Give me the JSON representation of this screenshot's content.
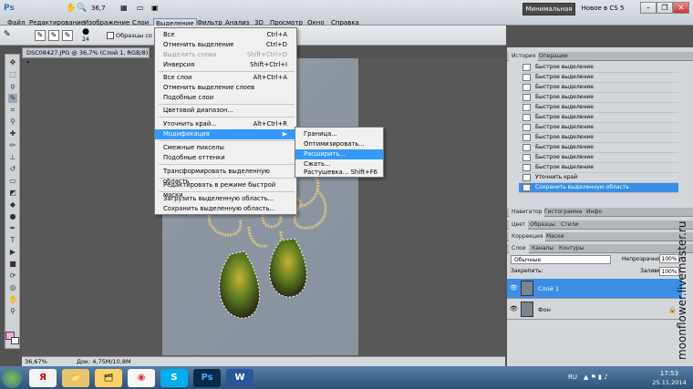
{
  "app": {
    "logo": "Ps",
    "menus": [
      "Файл",
      "Редактирование",
      "Изображение",
      "Слои",
      "Выделение",
      "Фильтр",
      "Анализ",
      "3D",
      "Просмотр",
      "Окно",
      "Справка"
    ],
    "zoom_display": "36,7",
    "workspace_button": "Минимальная",
    "news_button": "Новое в CS 5"
  },
  "options_bar": {
    "brush_size": "24",
    "sample_all_layers": "Образцы со всех сл"
  },
  "document": {
    "tab_title": "DSC08427.JPG @ 36,7% (Слой 1, RGB/8) *",
    "zoom": "36,67%",
    "doc_size": "Док: 4,75M/10,8M"
  },
  "select_menu": {
    "items": [
      {
        "label": "Все",
        "shortcut": "Ctrl+A"
      },
      {
        "label": "Отменить выделение",
        "shortcut": "Ctrl+D"
      },
      {
        "label": "Выделить снова",
        "shortcut": "Shift+Ctrl+D"
      },
      {
        "label": "Инверсия",
        "shortcut": "Shift+Ctrl+I"
      },
      {
        "label": "Все слои",
        "shortcut": "Alt+Ctrl+A"
      },
      {
        "label": "Отменить выделение слоев",
        "shortcut": ""
      },
      {
        "label": "Подобные слои",
        "shortcut": ""
      },
      {
        "label": "Цветовой диапазон...",
        "shortcut": ""
      },
      {
        "label": "Уточнить край...",
        "shortcut": "Alt+Ctrl+R"
      },
      {
        "label": "Модификация",
        "shortcut": ""
      },
      {
        "label": "Смежные пикселы",
        "shortcut": ""
      },
      {
        "label": "Подобные оттенки",
        "shortcut": ""
      },
      {
        "label": "Трансформировать выделенную область",
        "shortcut": ""
      },
      {
        "label": "Редактировать в режиме быстрой маски",
        "shortcut": ""
      },
      {
        "label": "Загрузить выделенную область...",
        "shortcut": ""
      },
      {
        "label": "Сохранить выделенную область...",
        "shortcut": ""
      }
    ]
  },
  "modify_submenu": {
    "items": [
      {
        "label": "Граница...",
        "shortcut": ""
      },
      {
        "label": "Оптимизировать...",
        "shortcut": ""
      },
      {
        "label": "Расширить...",
        "shortcut": ""
      },
      {
        "label": "Сжать...",
        "shortcut": ""
      },
      {
        "label": "Растушевка...",
        "shortcut": "Shift+F6"
      }
    ]
  },
  "history_panel": {
    "tabs": [
      "История",
      "Операции"
    ],
    "rows": [
      "Быстрое выделение",
      "Быстрое выделение",
      "Быстрое выделение",
      "Быстрое выделение",
      "Быстрое выделение",
      "Быстрое выделение",
      "Быстрое выделение",
      "Быстрое выделение",
      "Быстрое выделение",
      "Быстрое выделение",
      "Быстрое выделение",
      "Уточнить край",
      "Сохранить выделенную область"
    ]
  },
  "navigator_tabs": [
    "Навигатор",
    "Гистограмма",
    "Инфо"
  ],
  "color_tabs": [
    "Цвет",
    "Образцы",
    "Стили"
  ],
  "correction_tabs": [
    "Коррекция",
    "Маски"
  ],
  "layers_panel": {
    "tabs": [
      "Слои",
      "Каналы",
      "Контуры"
    ],
    "blend_mode": "Обычные",
    "opacity_label": "Непрозрачность:",
    "opacity_value": "100%",
    "lock_label": "Закрепить:",
    "fill_label": "Заливка:",
    "fill_value": "100%",
    "layers": [
      {
        "name": "Слой 1"
      },
      {
        "name": "Фон"
      }
    ]
  },
  "taskbar": {
    "lang": "RU",
    "time": "17:53",
    "date": "25.11.2014"
  },
  "watermark": "moonflower.livemaster.ru",
  "colors": {
    "highlight": "#3399ff",
    "foreground_swatch": "#f3a7e7"
  }
}
